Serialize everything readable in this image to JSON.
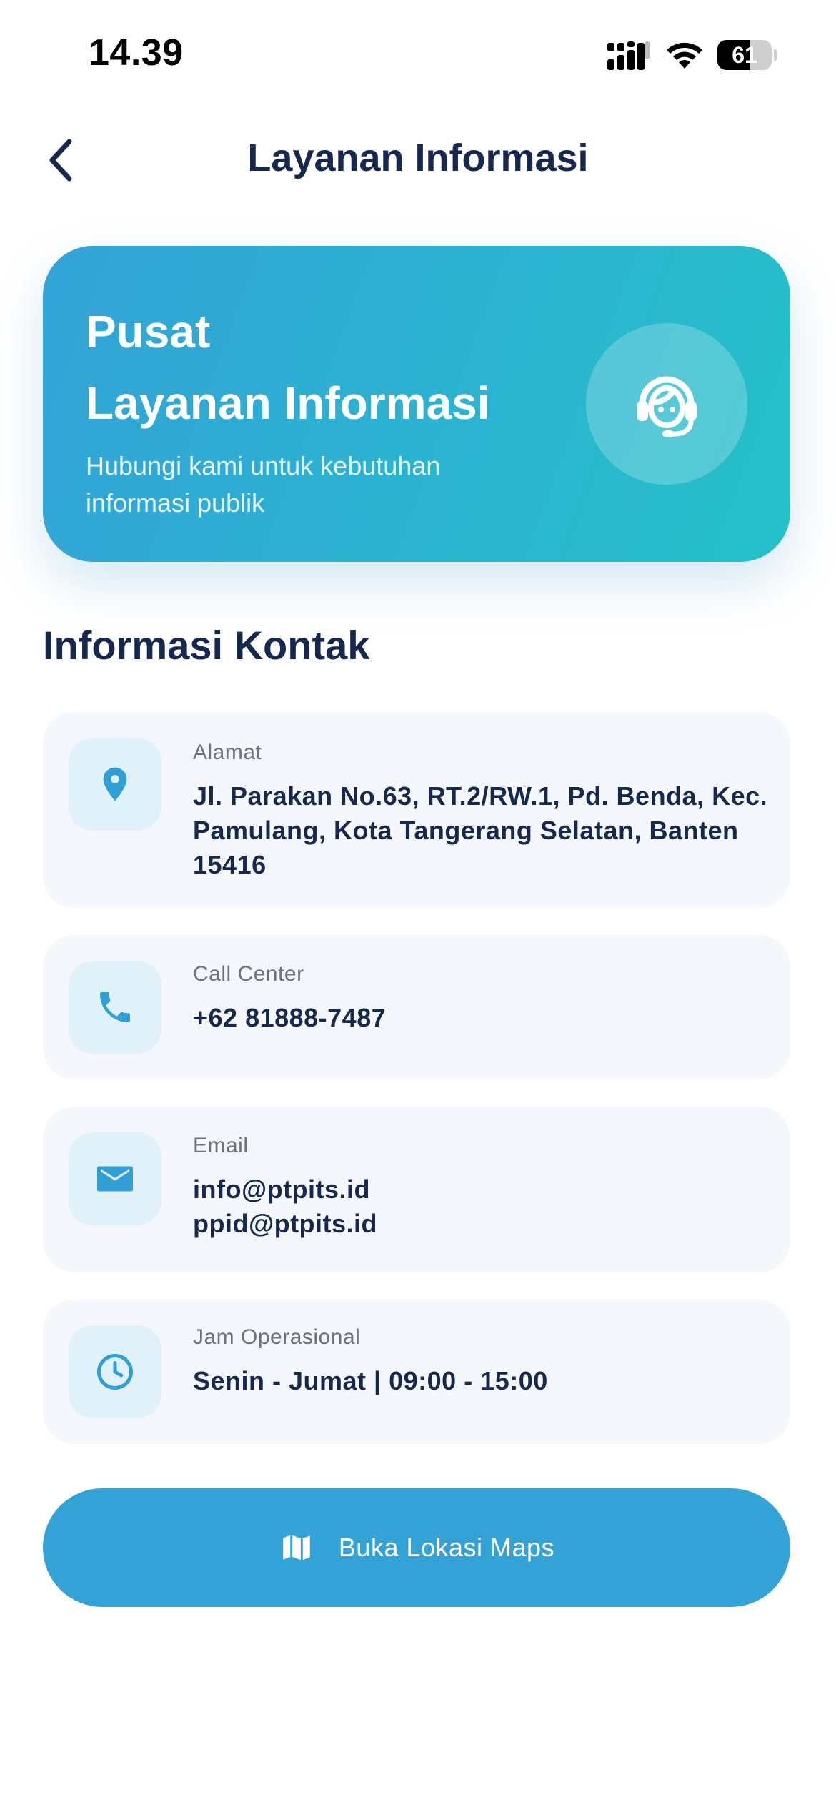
{
  "status_bar": {
    "time": "14.39",
    "battery": "61",
    "battery_level": 0.61
  },
  "header": {
    "title": "Layanan Informasi"
  },
  "hero": {
    "title_line1": "Pusat",
    "title_line2": "Layanan Informasi",
    "subtitle_line1": "Hubungi kami untuk kebutuhan",
    "subtitle_line2": "informasi publik",
    "icon": "headset-agent-icon"
  },
  "section": {
    "title": "Informasi Kontak"
  },
  "contacts": [
    {
      "icon": "location-pin-icon",
      "label": "Alamat",
      "lines": [
        "Jl. Parakan No.63, RT.2/RW.1, Pd. Benda, Kec.",
        "Pamulang, Kota Tangerang Selatan, Banten",
        "15416"
      ]
    },
    {
      "icon": "phone-icon",
      "label": "Call Center",
      "lines": [
        "+62 81888-7487"
      ]
    },
    {
      "icon": "mail-icon",
      "label": "Email",
      "lines": [
        "info@ptpits.id",
        "ppid@ptpits.id"
      ]
    },
    {
      "icon": "clock-icon",
      "label": "Jam Operasional",
      "lines": [
        "Senin - Jumat | 09:00 - 15:00"
      ]
    }
  ],
  "maps_button": {
    "label": "Buka Lokasi Maps",
    "icon": "map-icon"
  },
  "colors": {
    "primary": "#32a2d7",
    "navy": "#17284f",
    "card_bg": "#f4f8fc",
    "icon_bg": "#e0f1f9",
    "hero_gradient_start": "#33a3d8",
    "hero_gradient_end": "#24c0c8"
  }
}
